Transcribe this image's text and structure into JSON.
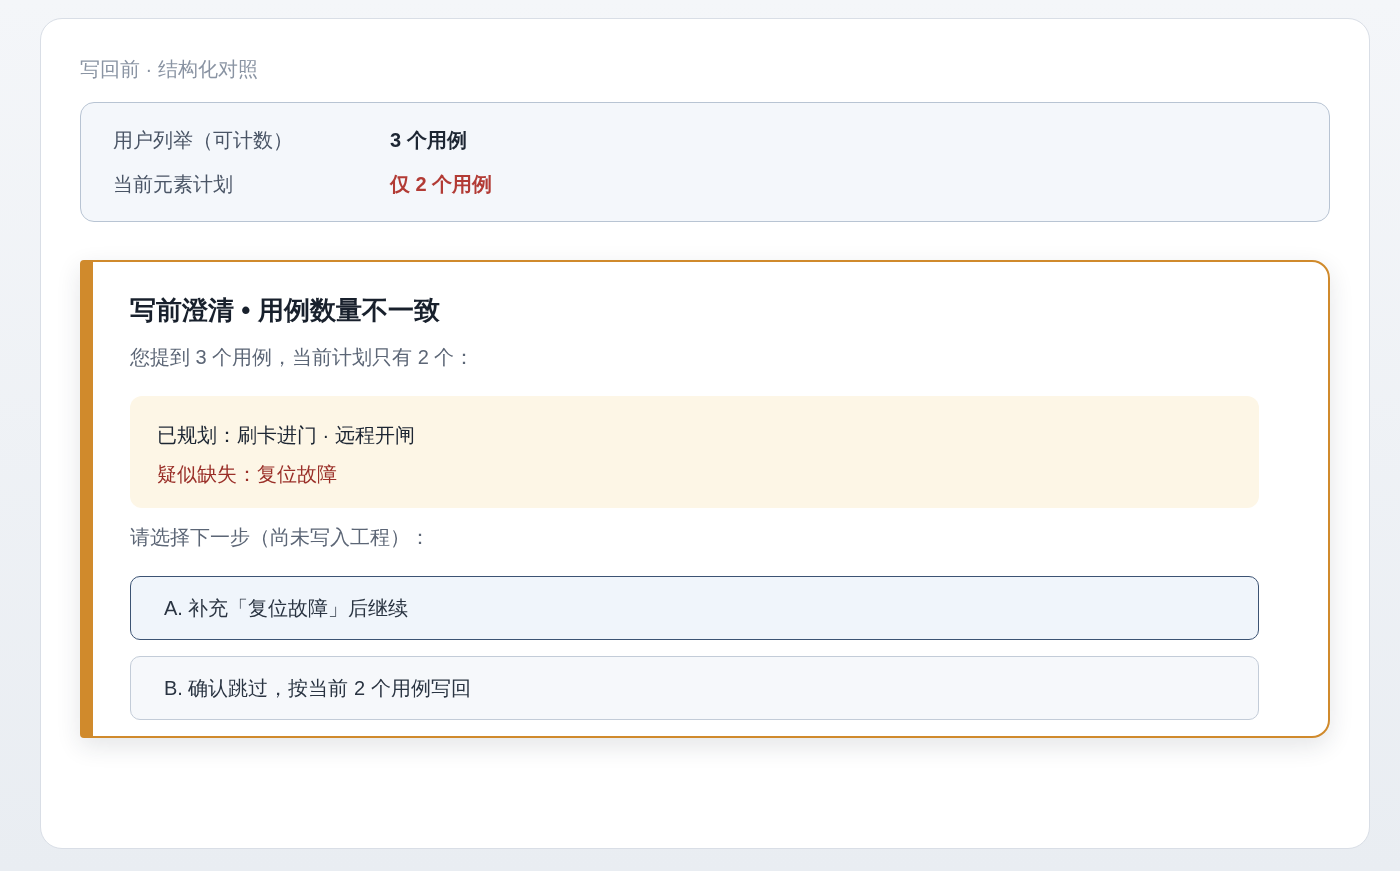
{
  "section_title": "写回前 · 结构化对照",
  "comparison": [
    {
      "label": "用户列举（可计数）",
      "value": "3 个用例",
      "kind": "normal"
    },
    {
      "label": "当前元素计划",
      "value": "仅 2 个用例",
      "kind": "warning"
    }
  ],
  "dialog": {
    "title": "写前澄清 • 用例数量不一致",
    "message": "您提到 3 个用例，当前计划只有 2 个：",
    "summary": [
      {
        "text": "已规划：刷卡进门 · 远程开闸",
        "kind": "normal"
      },
      {
        "text": "疑似缺失：复位故障",
        "kind": "warning"
      }
    ],
    "prompt": "请选择下一步（尚未写入工程）：",
    "options": [
      {
        "label": "A. 补充「复位故障」后继续",
        "selected": true
      },
      {
        "label": "B. 确认跳过，按当前 2 个用例写回",
        "selected": false
      }
    ]
  }
}
